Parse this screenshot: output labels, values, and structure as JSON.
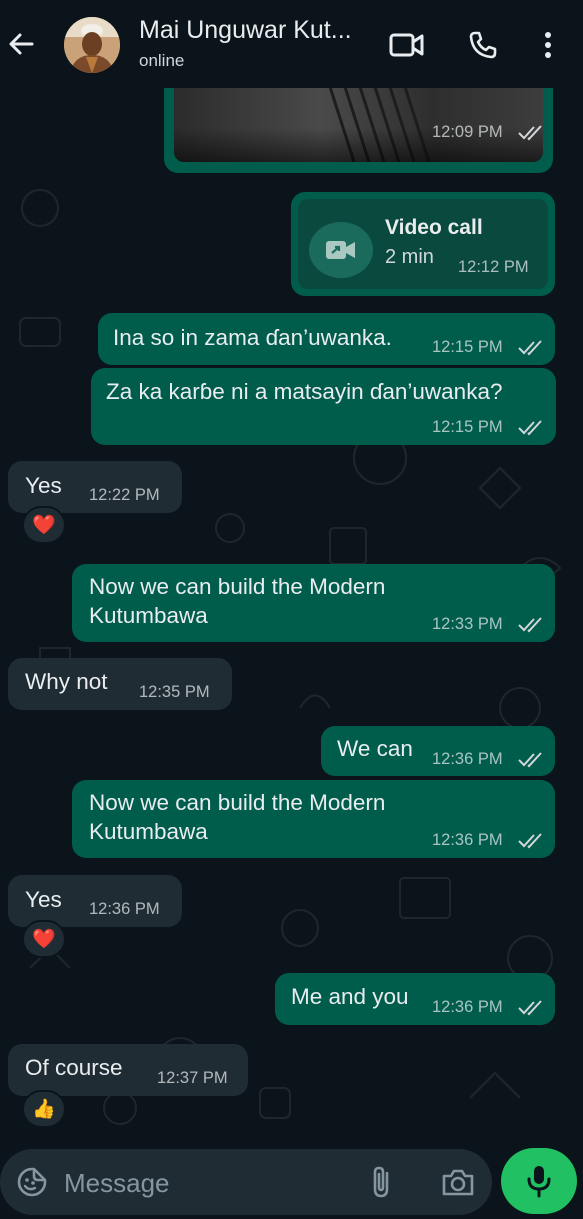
{
  "header": {
    "contact_name": "Mai Unguwar Kut...",
    "status": "online"
  },
  "messages": [
    {
      "time": "12:09 PM"
    },
    {
      "call_title": "Video call",
      "call_duration": "2 min",
      "time": "12:12 PM"
    },
    {
      "text": "Ina so in zama ɗan’uwanka.",
      "time": "12:15 PM"
    },
    {
      "text": "Za ka karɓe ni a matsayin ɗan’uwanka?",
      "time": "12:15 PM"
    },
    {
      "text": "Yes",
      "time": "12:22 PM",
      "reaction": "❤️"
    },
    {
      "line1": "Now we can build the Modern",
      "line2": "Kutumbawa",
      "time": "12:33 PM"
    },
    {
      "text": "Why not",
      "time": "12:35 PM"
    },
    {
      "text": "We can",
      "time": "12:36 PM"
    },
    {
      "line1": "Now we can build the Modern",
      "line2": "Kutumbawa",
      "time": "12:36 PM"
    },
    {
      "text": "Yes",
      "time": "12:36 PM",
      "reaction": "❤️"
    },
    {
      "text": "Me and you",
      "time": "12:36 PM"
    },
    {
      "text": "Of course",
      "time": "12:37 PM",
      "reaction": "👍"
    }
  ],
  "composer": {
    "placeholder": "Message"
  },
  "colors": {
    "background": "#0b141a",
    "outgoing_bubble": "#005c4b",
    "incoming_bubble": "#202c33",
    "read_ticks": "#53bdeb",
    "mic_button": "#21c063"
  }
}
